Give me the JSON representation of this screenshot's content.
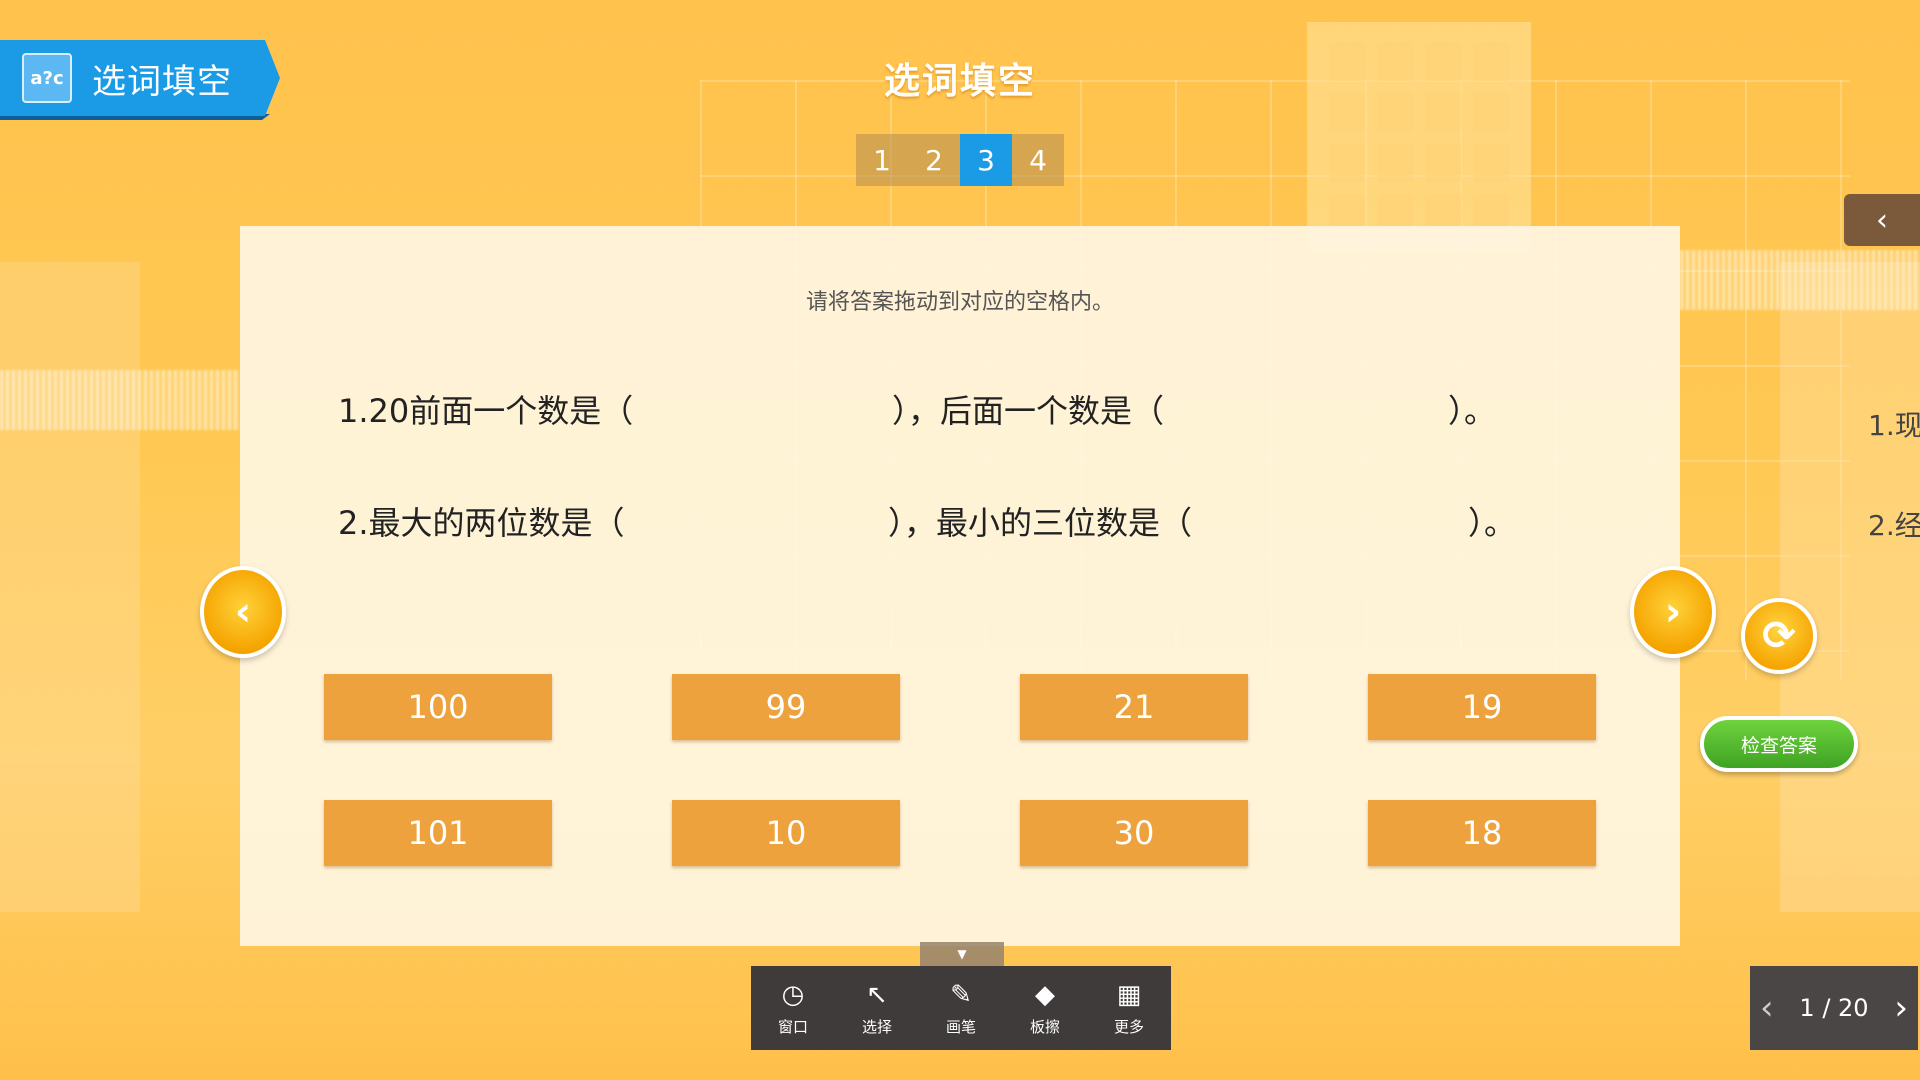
{
  "badge": {
    "icon_text": "a?c",
    "title": "选词填空"
  },
  "header": {
    "title": "选词填空",
    "tabs": [
      {
        "label": "1",
        "active": false
      },
      {
        "label": "2",
        "active": false
      },
      {
        "label": "3",
        "active": true
      },
      {
        "label": "4",
        "active": false
      }
    ]
  },
  "card": {
    "instruction": "请将答案拖动到对应的空格内。",
    "q1": {
      "a": "1.20前面一个数是（",
      "b": "），后面一个数是（",
      "c": "）。"
    },
    "q2": {
      "a": "2.最大的两位数是（",
      "b": "），最小的三位数是（",
      "c": "）。"
    },
    "options_row1": [
      "100",
      "99",
      "21",
      "19"
    ],
    "options_row2": [
      "101",
      "10",
      "30",
      "18"
    ]
  },
  "right": {
    "collapse_icon": "‹",
    "peek_1": "1.现",
    "peek_2": "2.经",
    "reset_icon": "⟳",
    "check_label": "检查答案"
  },
  "nav": {
    "left_icon": "‹",
    "right_icon": "›"
  },
  "toolbar": {
    "handle_icon": "▼",
    "items": [
      {
        "icon": "◷",
        "label": "窗口"
      },
      {
        "icon": "↖",
        "label": "选择"
      },
      {
        "icon": "✎",
        "label": "画笔"
      },
      {
        "icon": "◆",
        "label": "板擦"
      },
      {
        "icon": "▦",
        "label": "更多"
      }
    ]
  },
  "pager": {
    "prev": "‹",
    "label": "1 / 20",
    "next": "›"
  },
  "colors": {
    "accent_blue": "#1b9ae6",
    "option_orange": "#eea23e",
    "check_green": "#4fb82e"
  }
}
